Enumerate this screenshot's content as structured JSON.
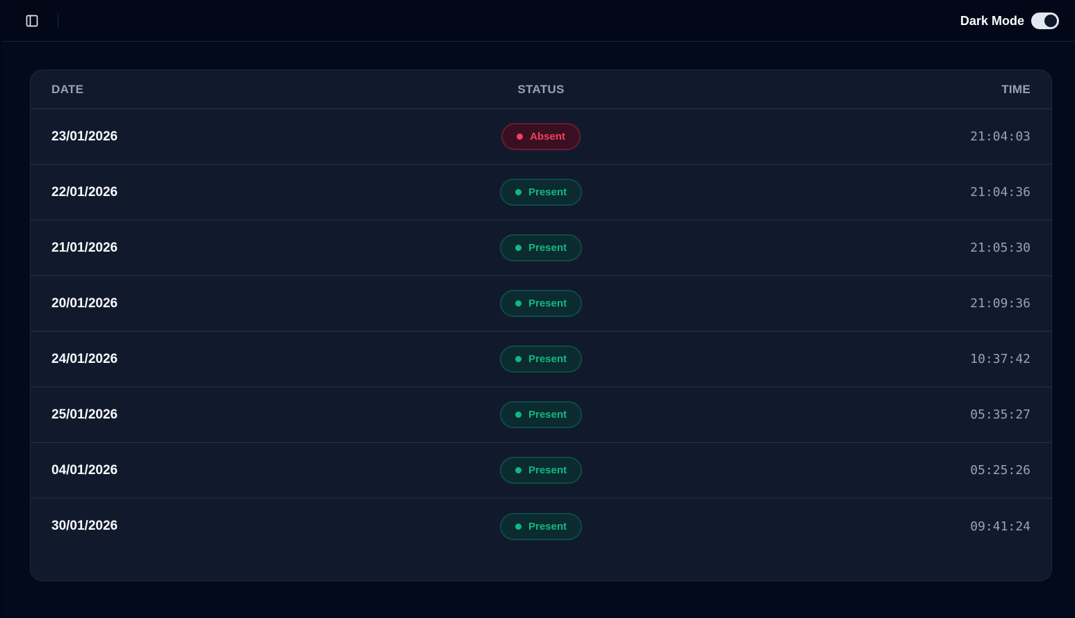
{
  "header": {
    "dark_mode_label": "Dark Mode",
    "dark_mode_on": true
  },
  "table": {
    "columns": [
      "DATE",
      "STATUS",
      "TIME"
    ],
    "rows": [
      {
        "date": "23/01/2026",
        "status": "Absent",
        "time": "21:04:03"
      },
      {
        "date": "22/01/2026",
        "status": "Present",
        "time": "21:04:36"
      },
      {
        "date": "21/01/2026",
        "status": "Present",
        "time": "21:05:30"
      },
      {
        "date": "20/01/2026",
        "status": "Present",
        "time": "21:09:36"
      },
      {
        "date": "24/01/2026",
        "status": "Present",
        "time": "10:37:42"
      },
      {
        "date": "25/01/2026",
        "status": "Present",
        "time": "05:35:27"
      },
      {
        "date": "04/01/2026",
        "status": "Present",
        "time": "05:25:26"
      },
      {
        "date": "30/01/2026",
        "status": "Present",
        "time": "09:41:24"
      }
    ]
  },
  "colors": {
    "present": "#10b981",
    "absent": "#f43f5e",
    "background": "#020817",
    "card": "#111a2d"
  },
  "icons": {
    "sidebar_toggle": "panel-left-icon"
  }
}
